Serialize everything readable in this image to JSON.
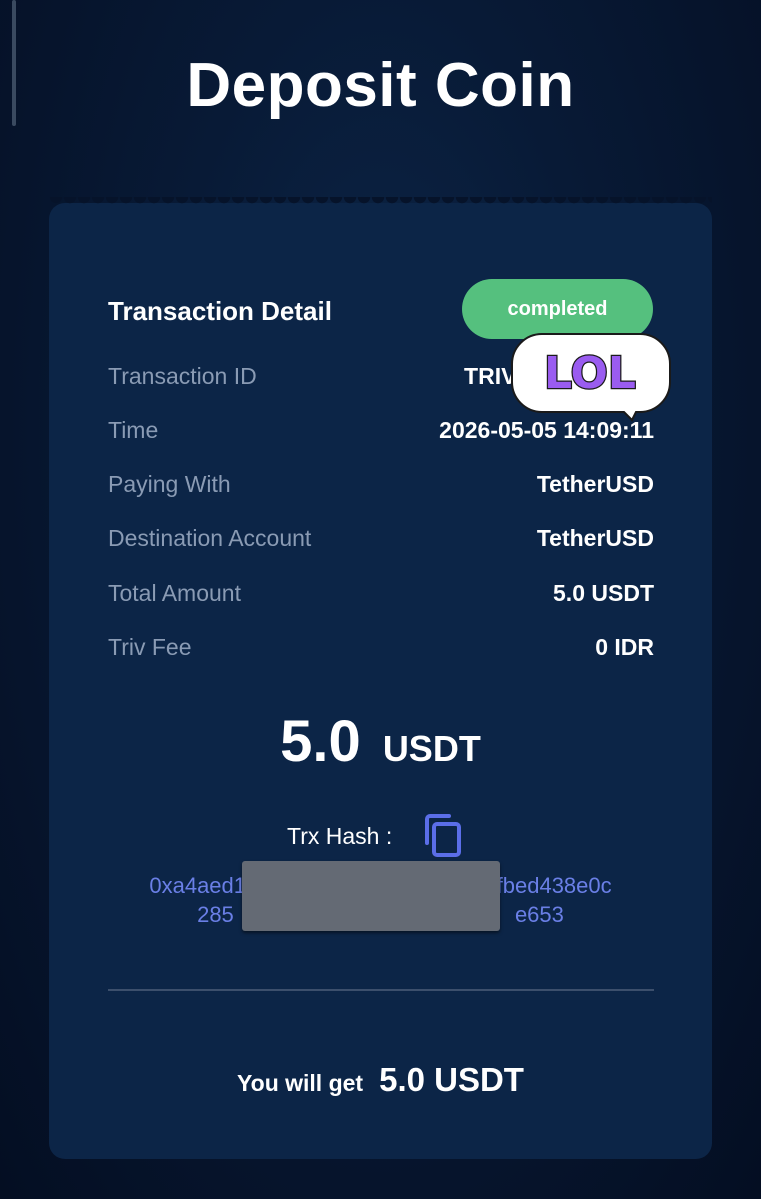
{
  "header": {
    "title": "Deposit Coin"
  },
  "detail": {
    "heading": "Transaction Detail",
    "status": "completed",
    "rows": [
      {
        "label": "Transaction ID",
        "value": "TRIV-4I"
      },
      {
        "label": "Time",
        "value": "2026-05-05 14:09:11"
      },
      {
        "label": "Paying With",
        "value": "TetherUSD"
      },
      {
        "label": "Destination Account",
        "value": "TetherUSD"
      },
      {
        "label": "Total Amount",
        "value": "5.0 USDT"
      },
      {
        "label": "Triv Fee",
        "value": "0 IDR"
      }
    ]
  },
  "amount": {
    "value": "5.0",
    "unit": "USDT"
  },
  "trx": {
    "label": "Trx Hash :",
    "hash_line1": "0xa4aed187                                   9fbed438e0c",
    "hash_line2": "285                                              e653"
  },
  "summary": {
    "label": "You will get",
    "value": "5.0 USDT"
  },
  "sticker": {
    "text": "LOL"
  },
  "colors": {
    "accent": "#55c07e",
    "link": "#6a7fe6",
    "card": "#0c2547"
  }
}
